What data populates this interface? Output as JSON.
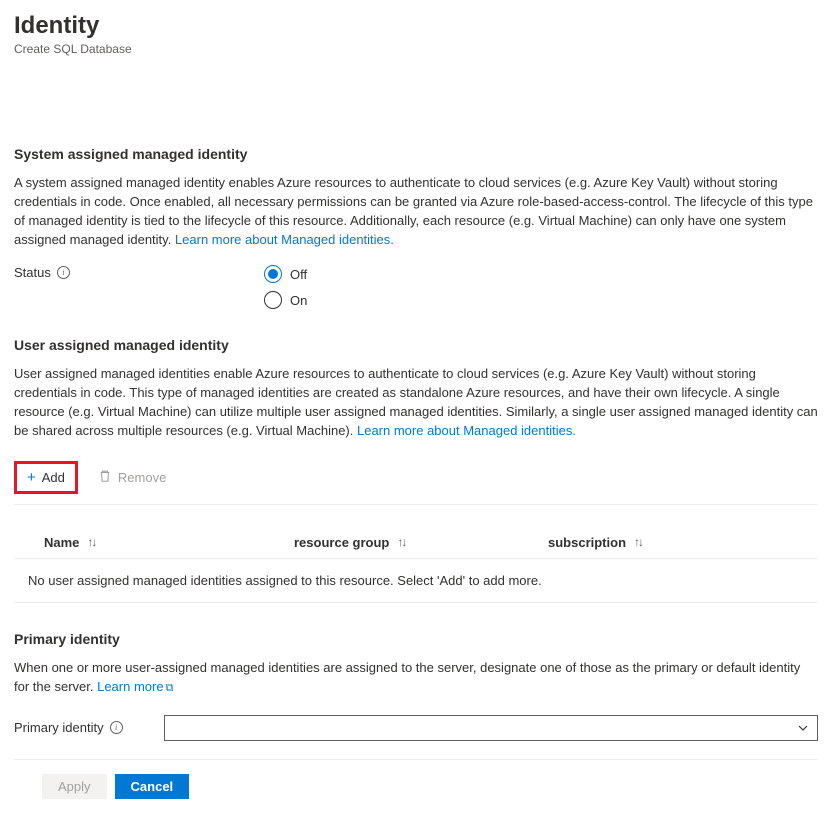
{
  "header": {
    "title": "Identity",
    "subtitle": "Create SQL Database"
  },
  "systemSection": {
    "heading": "System assigned managed identity",
    "desc_prefix": "A system assigned managed identity enables Azure resources to authenticate to cloud services (e.g. Azure Key Vault) without storing credentials in code. Once enabled, all necessary permissions can be granted via Azure role-based-access-control. The lifecycle of this type of managed identity is tied to the lifecycle of this resource. Additionally, each resource (e.g. Virtual Machine) can only have one system assigned managed identity. ",
    "link": "Learn more about Managed identities.",
    "statusLabel": "Status",
    "options": {
      "off": "Off",
      "on": "On"
    },
    "selected": "off"
  },
  "userSection": {
    "heading": "User assigned managed identity",
    "desc_prefix": "User assigned managed identities enable Azure resources to authenticate to cloud services (e.g. Azure Key Vault) without storing credentials in code. This type of managed identities are created as standalone Azure resources, and have their own lifecycle. A single resource (e.g. Virtual Machine) can utilize multiple user assigned managed identities. Similarly, a single user assigned managed identity can be shared across multiple resources (e.g. Virtual Machine). ",
    "link": "Learn more about Managed identities.",
    "toolbar": {
      "add": "Add",
      "remove": "Remove"
    },
    "columns": {
      "name": "Name",
      "rg": "resource group",
      "sub": "subscription"
    },
    "emptyMessage": "No user assigned managed identities assigned to this resource. Select 'Add' to add more."
  },
  "primarySection": {
    "heading": "Primary identity",
    "desc_prefix": "When one or more user-assigned managed identities are assigned to the server, designate one of those as the primary or default identity for the server. ",
    "link": "Learn more",
    "label": "Primary identity"
  },
  "actions": {
    "apply": "Apply",
    "cancel": "Cancel"
  }
}
